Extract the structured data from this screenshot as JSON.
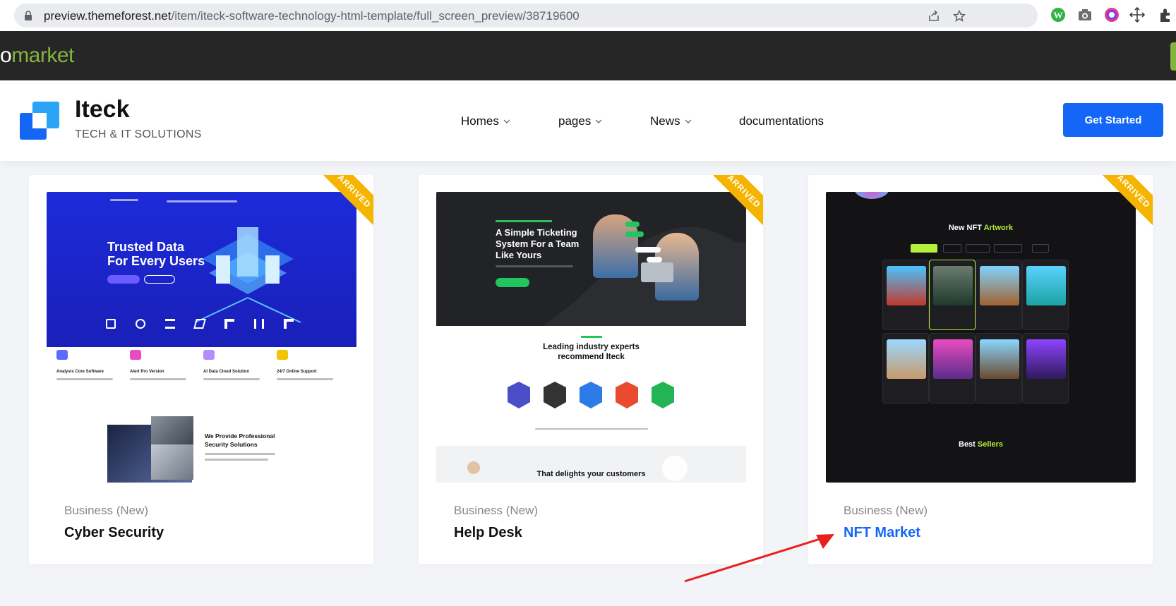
{
  "browser": {
    "url_host": "preview.themeforest.net",
    "url_path": "/item/iteck-software-technology-html-template/full_screen_preview/38719600"
  },
  "marketplace": {
    "logo": "market",
    "logo_prefix": "o"
  },
  "header": {
    "brand_name": "Iteck",
    "brand_tagline": "TECH & IT SOLUTIONS",
    "nav": [
      {
        "label": "Homes",
        "has_dropdown": true
      },
      {
        "label": "pages",
        "has_dropdown": true
      },
      {
        "label": "News",
        "has_dropdown": true
      },
      {
        "label": "documentations",
        "has_dropdown": false
      }
    ],
    "cta_label": "Get Started",
    "accent": "#1466f7"
  },
  "cards": [
    {
      "category": "Business (New)",
      "title": "Cyber Security",
      "badge": "ARRIVED",
      "preview": {
        "hero_line1": "Trusted Data",
        "hero_line2": "For Every Users",
        "features": [
          "Analysis Core Software",
          "Alert Pro Version",
          "AI Data Cloud Solution",
          "24/7 Online Support"
        ],
        "section_title_1": "We Provide Professional",
        "section_title_2": "Security Solutions"
      }
    },
    {
      "category": "Business (New)",
      "title": "Help Desk",
      "badge": "ARRIVED",
      "preview": {
        "hero_line1": "A Simple Ticketing",
        "hero_line2": "System For a Team",
        "hero_line3": "Like Yours",
        "section_title_1": "Leading industry experts",
        "section_title_2": "recommend Iteck",
        "footer_text": "That delights your customers"
      }
    },
    {
      "category": "Business (New)",
      "title": "NFT Market",
      "badge": "ARRIVED",
      "preview": {
        "heading_a": "New NFT",
        "heading_b": "Artwork",
        "sellers_a": "Best",
        "sellers_b": "Sellers"
      }
    }
  ],
  "colors": {
    "ribbon": "#f5b400",
    "annotation_arrow": "#e8201c",
    "tf_green": "#82b440"
  }
}
